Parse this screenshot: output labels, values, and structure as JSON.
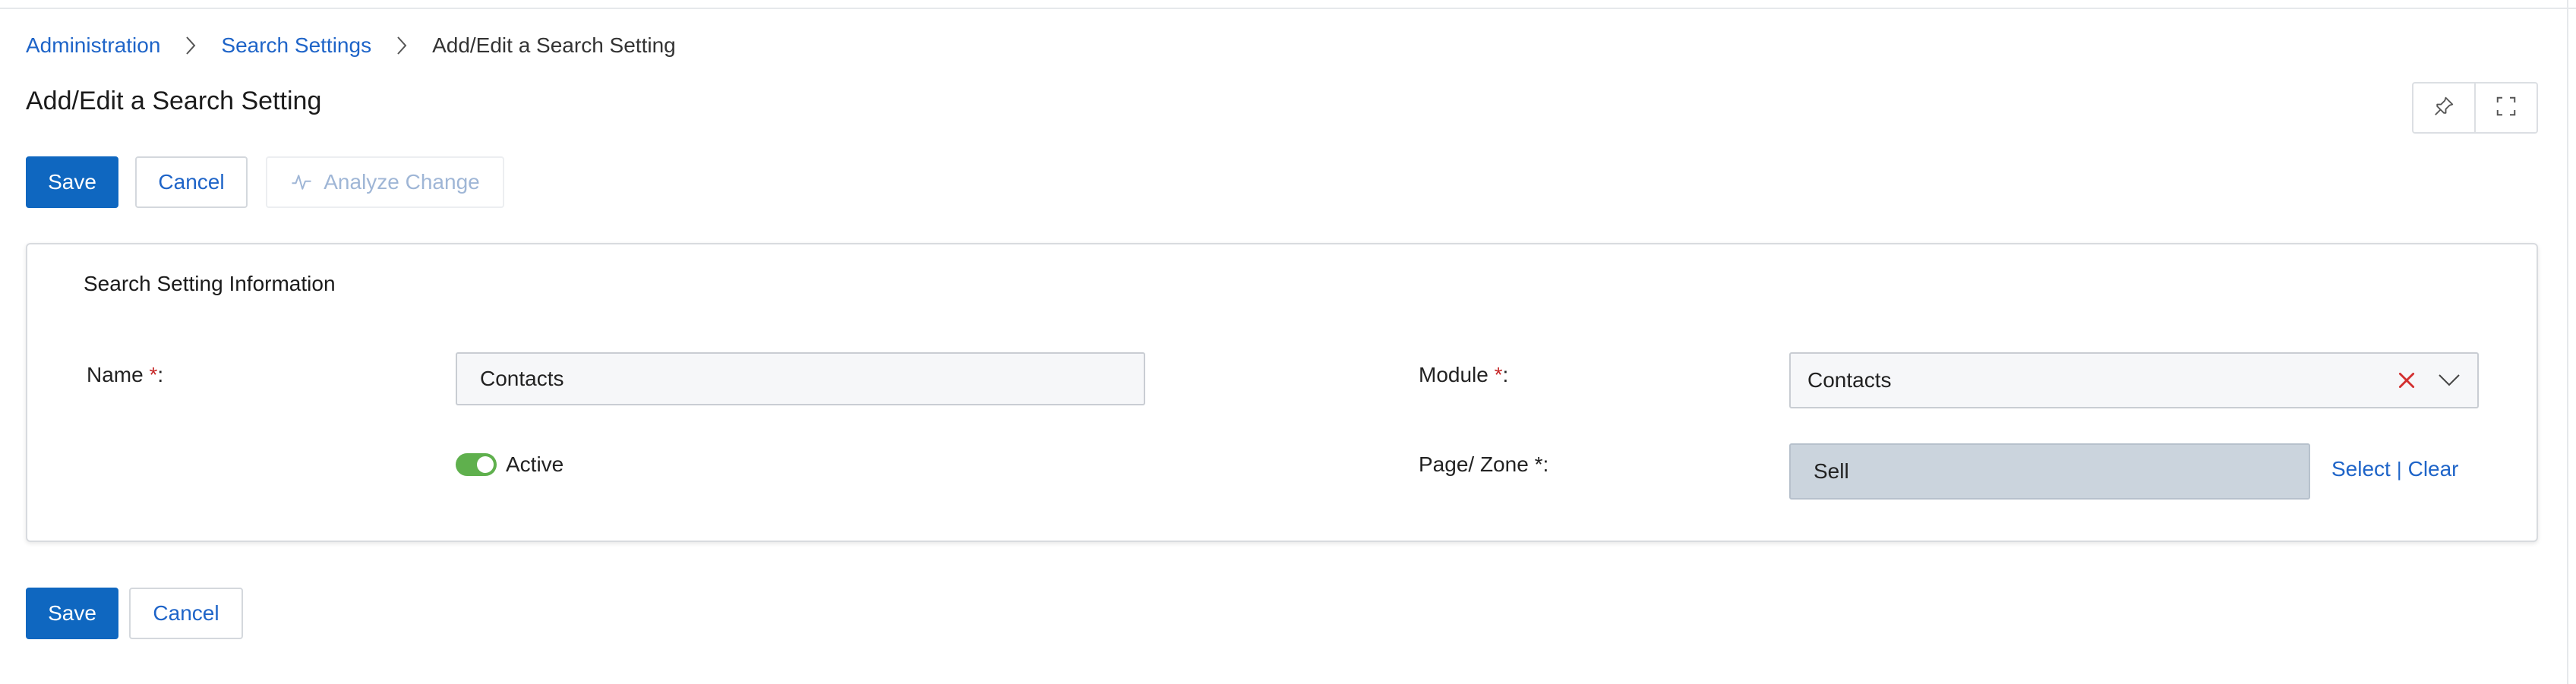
{
  "breadcrumb": {
    "items": [
      "Administration",
      "Search Settings"
    ],
    "current": "Add/Edit a Search Setting"
  },
  "page": {
    "title": "Add/Edit a Search Setting"
  },
  "toolbar": {
    "save_label": "Save",
    "cancel_label": "Cancel",
    "analyze_label": "Analyze Change"
  },
  "section": {
    "title": "Search Setting Information"
  },
  "form": {
    "name_label": "Name",
    "name_value": "Contacts",
    "active_label": "Active",
    "active_checked": true,
    "module_label": "Module",
    "module_value": "Contacts",
    "page_zone_label": "Page/ Zone",
    "page_zone_value": "Sell",
    "select_link": "Select",
    "link_separator": "|",
    "clear_link": "Clear",
    "required_mark": "*",
    "label_suffix": ":"
  },
  "footer": {
    "save_label": "Save",
    "cancel_label": "Cancel"
  },
  "icons": {
    "breadcrumb_separator": "chevron-right-icon",
    "pin": "pin-icon",
    "fullscreen": "fullscreen-icon",
    "analyze": "activity-icon",
    "clear_selection": "close-icon",
    "dropdown": "chevron-down-icon"
  },
  "colors": {
    "primary": "#0f67c0",
    "link": "#1e64c8",
    "required": "#c62828",
    "toggle_on": "#5fb04d",
    "readonly_bg": "#cbd4dd"
  }
}
